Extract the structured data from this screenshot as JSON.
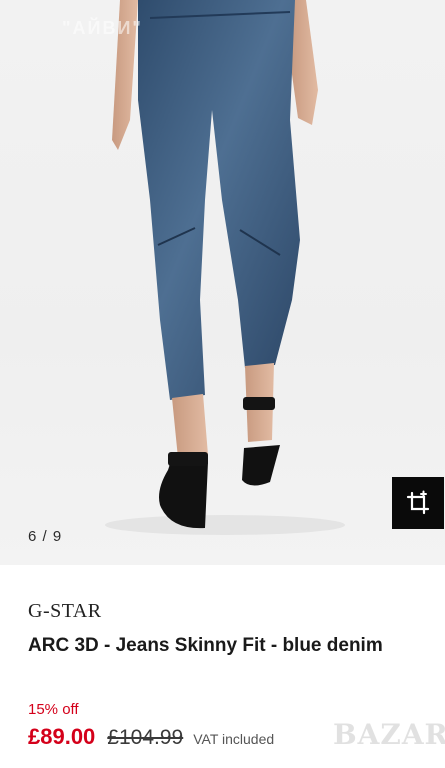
{
  "gallery": {
    "watermark_top": "\"АЙВИ\"",
    "counter": "6 / 9"
  },
  "product": {
    "brand": "G-STAR",
    "title": "ARC 3D - Jeans Skinny Fit - blue denim",
    "discount": "15% off",
    "price_current": "£89.00",
    "price_original": "£104.99",
    "vat_note": "VAT included"
  },
  "watermark_logo": "BAZAR",
  "colors": {
    "accent_red": "#d4001a",
    "denim": "#3d5878",
    "button_bg": "#0a0a0a"
  },
  "icons": {
    "crop": "crop-icon"
  }
}
